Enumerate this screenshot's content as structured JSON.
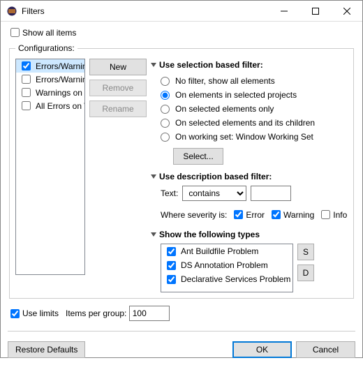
{
  "window": {
    "title": "Filters"
  },
  "show_all_label": "Show all items",
  "show_all_checked": false,
  "configurations": {
    "legend": "Configurations:",
    "items": [
      {
        "label": "Errors/Warnings on Project",
        "checked": true,
        "selected": true
      },
      {
        "label": "Errors/Warnings on Selection",
        "checked": false,
        "selected": false
      },
      {
        "label": "Warnings on Selection",
        "checked": false,
        "selected": false
      },
      {
        "label": "All Errors on Workspace",
        "checked": false,
        "selected": false
      }
    ],
    "buttons": {
      "new": "New",
      "remove": "Remove",
      "rename": "Rename"
    }
  },
  "selection_filter": {
    "header": "Use selection based filter:",
    "options": [
      "No filter, show all elements",
      "On elements in selected projects",
      "On selected elements only",
      "On selected elements and its children",
      "On working set:  Window Working Set"
    ],
    "selected_index": 1,
    "select_button": "Select..."
  },
  "description_filter": {
    "header": "Use description based filter:",
    "text_label": "Text:",
    "mode": "contains",
    "value": "",
    "severity_label": "Where severity is:",
    "error_label": "Error",
    "error_checked": true,
    "warning_label": "Warning",
    "warning_checked": true,
    "info_label": "Info",
    "info_checked": false
  },
  "types": {
    "header": "Show the following types",
    "items": [
      {
        "label": "Ant Buildfile Problem",
        "checked": true
      },
      {
        "label": "DS Annotation Problem",
        "checked": true
      },
      {
        "label": "Declarative Services Problem",
        "checked": true
      }
    ],
    "select_all": "Select All",
    "deselect_all": "Deselect All"
  },
  "limits": {
    "use_limits_label": "Use limits",
    "use_limits_checked": true,
    "items_per_group_label": "Items per group:",
    "items_per_group_value": "100"
  },
  "actions": {
    "restore": "Restore Defaults",
    "ok": "OK",
    "cancel": "Cancel"
  }
}
